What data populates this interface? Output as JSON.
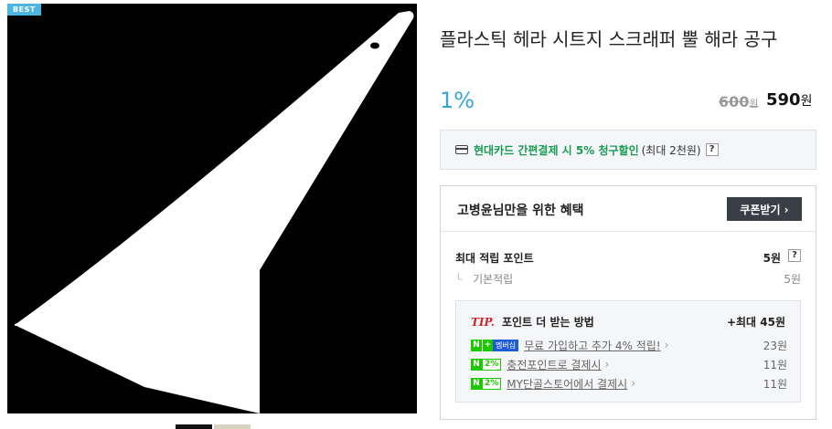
{
  "image": {
    "badge": "BEST"
  },
  "product": {
    "title": "플라스틱 헤라 시트지 스크래퍼 뿔 해라 공구",
    "discount": "1%",
    "original_price": "600",
    "sale_price": "590",
    "won": "원"
  },
  "card_promo": {
    "text": "현대카드 간편결제 시 5% 청구할인",
    "note": "(최대 2천원)",
    "help": "?"
  },
  "benefit": {
    "title": "고병윤님만을 위한 혜택",
    "coupon_label": "쿠폰받기 ›",
    "max_points_label": "최대 적립 포인트",
    "max_points_value": "5원",
    "help": "?",
    "basic_label": "기본적립",
    "basic_value": "5원",
    "tip": {
      "mark": "TIP.",
      "title": "포인트 더 받는 방법",
      "max": "+최대 45원",
      "rows": [
        {
          "badge_type": "membership",
          "badge_n": "N",
          "badge_plus": "+",
          "badge_member": "멤버십",
          "text": "무료 가입하고 추가 4% 적립!",
          "value": "23원"
        },
        {
          "badge_type": "percent",
          "badge_n": "N",
          "badge_pct": "2%",
          "text": "충전포인트로 결제시",
          "value": "11원"
        },
        {
          "badge_type": "percent",
          "badge_n": "N",
          "badge_pct": "2%",
          "text": "MY단골스토어에서 결제시",
          "value": "11원"
        }
      ]
    }
  },
  "colors": {
    "accent": "#37a6d6",
    "green": "#1ec800",
    "tip_red": "#d0242b"
  }
}
